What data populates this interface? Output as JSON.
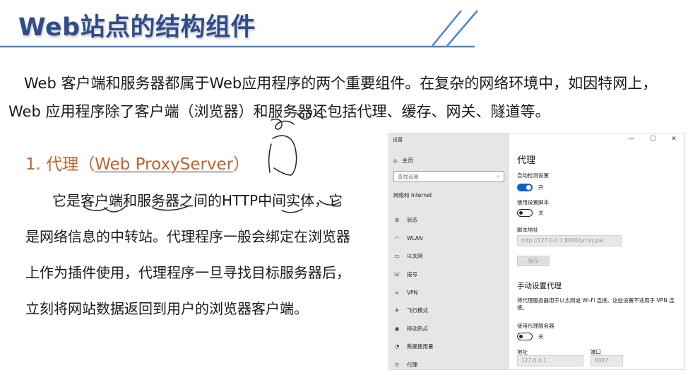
{
  "slide": {
    "title": "Web站点的结构组件",
    "intro_line1": "Web  客户端和服务器都属于Web应用程序的两个重要组件。在复杂的网络环境中，如因特网上，",
    "intro_line2": "Web 应用程序除了客户端（浏览器）和服务器还包括代理、缓存、网关、隧道等。",
    "section_number": "1. 代理（",
    "section_name": "Web ProxyServer",
    "section_close": "）",
    "desc_lines": [
      "它是客户端和服务器之间的HTTP中间实体，它",
      "是网络信息的中转站。代理程序一般会绑定在浏览器",
      "上作为插件使用，代理程序一旦寻找目标服务器后，",
      "立刻将网站数据返回到用户的浏览器客户端。"
    ]
  },
  "settings_window": {
    "app_title": "设置",
    "home_label": "主页",
    "search_placeholder": "查找设置",
    "group_label": "网络和 Internet",
    "nav_items": [
      {
        "label": "状态",
        "icon": "network-status-icon"
      },
      {
        "label": "WLAN",
        "icon": "wifi-icon"
      },
      {
        "label": "以太网",
        "icon": "ethernet-icon"
      },
      {
        "label": "拨号",
        "icon": "dialup-icon"
      },
      {
        "label": "VPN",
        "icon": "vpn-icon"
      },
      {
        "label": "飞行模式",
        "icon": "airplane-icon"
      },
      {
        "label": "移动热点",
        "icon": "hotspot-icon"
      },
      {
        "label": "数据使用量",
        "icon": "data-usage-icon"
      },
      {
        "label": "代理",
        "icon": "proxy-icon"
      }
    ],
    "titlebar": {
      "minimize": "—",
      "maximize": "☐",
      "close": "✕"
    },
    "content": {
      "page_title": "代理",
      "auto_detect_label": "自动检测设置",
      "auto_detect_state": "开",
      "use_script_label": "使用设置脚本",
      "use_script_state": "关",
      "script_address_label": "脚本地址",
      "script_address_value": "http://127.0.0.1:8086/proxy.pac",
      "save_button": "保存",
      "manual_title": "手动设置代理",
      "manual_note": "将代理服务器用于以太网或 Wi-Fi 连接。这些设置不适用于 VPN 连接。",
      "use_proxy_label": "使用代理服务器",
      "use_proxy_state": "关",
      "address_label": "地址",
      "address_value": "127.0.0.1",
      "port_label": "端口",
      "port_value": "8087"
    },
    "toggles": {
      "auto_detect": true,
      "use_script": false,
      "use_proxy": false
    }
  },
  "colors": {
    "title": "#2f4d8a",
    "rule": "#4f86c6",
    "heading": "#c2622d",
    "toggle_on": "#0a64c8"
  }
}
